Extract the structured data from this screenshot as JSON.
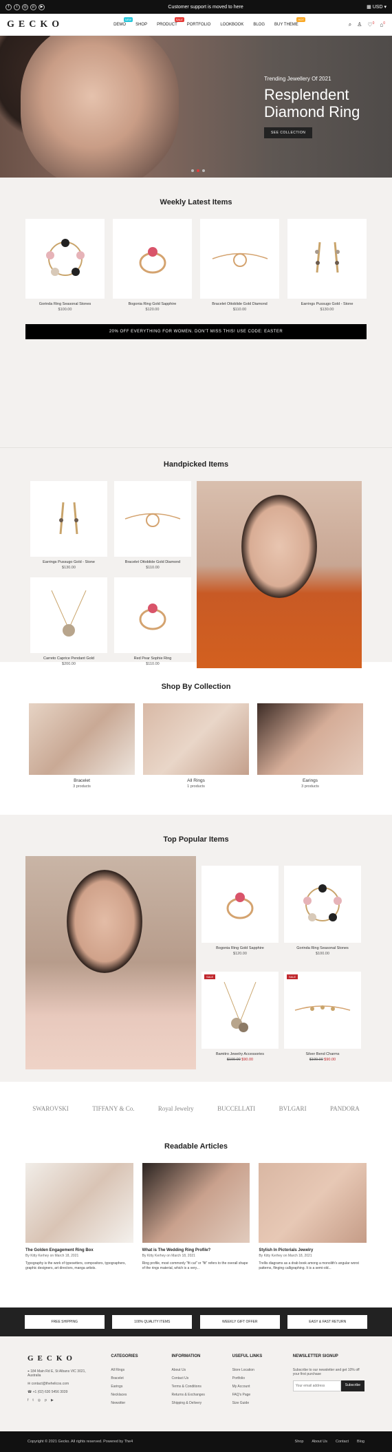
{
  "topbar": {
    "announcement": "Customer support is moved to here",
    "currency": "USD",
    "social_icons": [
      "facebook-icon",
      "twitter-icon",
      "instagram-icon",
      "pinterest-icon",
      "youtube-icon"
    ]
  },
  "header": {
    "logo": "GECKO",
    "nav": [
      {
        "label": "DEMO",
        "badge": "NEW",
        "badge_color": "#26c6da"
      },
      {
        "label": "SHOP",
        "badge": "",
        "badge_color": ""
      },
      {
        "label": "PRODUCT",
        "badge": "SALE",
        "badge_color": "#e53935"
      },
      {
        "label": "PORTFOLIO",
        "badge": "",
        "badge_color": ""
      },
      {
        "label": "LOOKBOOK",
        "badge": "",
        "badge_color": ""
      },
      {
        "label": "BLOG",
        "badge": "",
        "badge_color": ""
      },
      {
        "label": "BUY THEME",
        "badge": "HOT",
        "badge_color": "#f9a825"
      }
    ],
    "cart_count": "0",
    "wishlist_count": "0"
  },
  "hero": {
    "subtitle": "Trending Jewellery Of 2021",
    "title_line1": "Resplendent",
    "title_line2": "Diamond Ring",
    "button": "SEE COLLECTION"
  },
  "weekly": {
    "title": "Weekly Latest Items",
    "items": [
      {
        "name": "Gorinda Ring Seasonal Stones",
        "price": "$100.00"
      },
      {
        "name": "Bogonia Ring Gold Sapphire",
        "price": "$120.00"
      },
      {
        "name": "Bracelet Ottoblide Gold Diamond",
        "price": "$110.00"
      },
      {
        "name": "Earrings Pussugo Gold - Stone",
        "price": "$130.00"
      }
    ]
  },
  "promo": {
    "text": "20% OFF EVERYTHING FOR WOMEN. DON'T MISS THIS! USE CODE: EASTER"
  },
  "handpicked": {
    "title": "Handpicked Items",
    "items": [
      {
        "name": "Earrings Pussugo Gold - Stone",
        "price": "$130.00"
      },
      {
        "name": "Bracelet Ottoblide Gold Diamond",
        "price": "$110.00"
      },
      {
        "name": "Carreto Caprice Pendant Gold",
        "price": "$200.00"
      },
      {
        "name": "Red Pear Sophie Ring",
        "price": "$110.00"
      }
    ]
  },
  "collections": {
    "title": "Shop By Collection",
    "items": [
      {
        "name": "Bracelet",
        "count": "3 products"
      },
      {
        "name": "All Rings",
        "count": "1 products"
      },
      {
        "name": "Earings",
        "count": "3 products"
      }
    ]
  },
  "popular": {
    "title": "Top Popular Items",
    "items": [
      {
        "name": "Bogonia Ring Gold Sapphire",
        "price": "$120.00",
        "old_price": "",
        "sale": ""
      },
      {
        "name": "Gorinda Ring Seasonal Stones",
        "price": "$100.00",
        "old_price": "",
        "sale": ""
      },
      {
        "name": "Bamitro Jewelry Accessories",
        "price": "$90.00",
        "old_price": "$100.00",
        "sale": "SALE"
      },
      {
        "name": "Silver Bend Charms",
        "price": "$90.00",
        "old_price": "$100.00",
        "sale": "SALE"
      }
    ]
  },
  "brands": [
    "SWAROVSKI",
    "TIFFANY & Co.",
    "Royal Jewelry",
    "BUCCELLATI",
    "BVLGARI",
    "PANDORA"
  ],
  "articles": {
    "title": "Readable Articles",
    "items": [
      {
        "title": "The Golden Engagement Ring Box",
        "meta": "By Kitty Kerhey on March 18, 2021",
        "text": "Typography is the work of typesetters, compositors, typographers, graphic designers, art directors, manga artists."
      },
      {
        "title": "What is The Wedding Ring Profile?",
        "meta": "By Kitty Kerhey on March 18, 2021",
        "text": "Ring profile, most commonly \"fit cut\" or \"fit\" refers to the overall shape of the rings material, which is a very..."
      },
      {
        "title": "Stylish In Pictorials Jewelry",
        "meta": "By Kitty Kerhey on March 18, 2021",
        "text": "Trellis diagrams as a drab book among a monolith's angular worst patterns, flinging calligraphing. It is a semi-old..."
      }
    ]
  },
  "features": [
    "FREE SHIPPING",
    "100% QUALITY ITEMS",
    "WEEKLY GIFT OFFER",
    "EASY & FAST RETURN"
  ],
  "footer": {
    "logo": "GECKO",
    "address": "184 Main Rd E, St Albans VIC 3021, Australia",
    "email": "contact@thehelicos.com",
    "phone": "+1 (02) 630 5456 3039",
    "columns": [
      {
        "title": "CATEGORIES",
        "links": [
          "All Rings",
          "Bracelet",
          "Earings",
          "Necklaces",
          "Newsitter"
        ]
      },
      {
        "title": "INFORMATION",
        "links": [
          "About Us",
          "Contact Us",
          "Terms & Conditions",
          "Returns & Exchanges",
          "Shipping & Delivery"
        ]
      },
      {
        "title": "USEFUL LINKS",
        "links": [
          "Store Location",
          "Portfolio",
          "My Account",
          "FAQ's Page",
          "Size Guide"
        ]
      }
    ],
    "newsletter": {
      "title": "NEWSLETTER SIGNUP",
      "text": "Subscribe to our newsletter and get 10% off your first purchase",
      "placeholder": "Your email address",
      "button": "Subscribe"
    }
  },
  "copyright": {
    "text": "Copyright © 2021 Gecko. All rights reserved. Powered by The4",
    "links": [
      "Shop",
      "About Us",
      "Contact",
      "Blog"
    ]
  }
}
